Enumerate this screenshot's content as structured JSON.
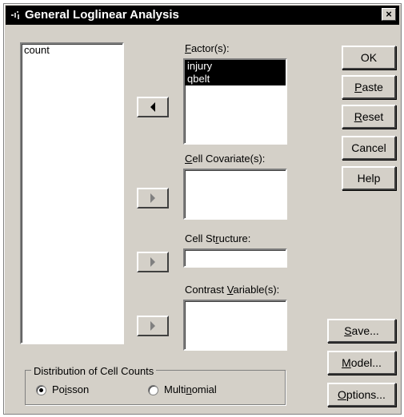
{
  "window": {
    "title": "General Loglinear Analysis",
    "close_glyph": "×"
  },
  "source_list": {
    "items": [
      "count"
    ]
  },
  "factors": {
    "label_u": "F",
    "label_rest": "actor(s):",
    "items": [
      "injury",
      "qbelt"
    ]
  },
  "cell_covariates": {
    "label_u": "C",
    "label_rest": "ell Covariate(s):"
  },
  "cell_structure": {
    "label_pre": "Cell St",
    "label_u": "r",
    "label_rest": "ucture:"
  },
  "contrast_variables": {
    "label_pre": "Contrast ",
    "label_u": "V",
    "label_rest": "ariable(s):"
  },
  "buttons": {
    "ok": "OK",
    "paste_u": "P",
    "paste_rest": "aste",
    "reset_u": "R",
    "reset_rest": "eset",
    "cancel": "Cancel",
    "help": "Help",
    "save_u": "S",
    "save_rest": "ave...",
    "model_u": "M",
    "model_rest": "odel...",
    "options_u": "O",
    "options_rest": "ptions..."
  },
  "distribution": {
    "title": "Distribution of Cell Counts",
    "poisson_pre": "Po",
    "poisson_u": "i",
    "poisson_rest": "sson",
    "multinomial_pre": "Multi",
    "multinomial_u": "n",
    "multinomial_rest": "omial",
    "selected": "Poisson"
  }
}
